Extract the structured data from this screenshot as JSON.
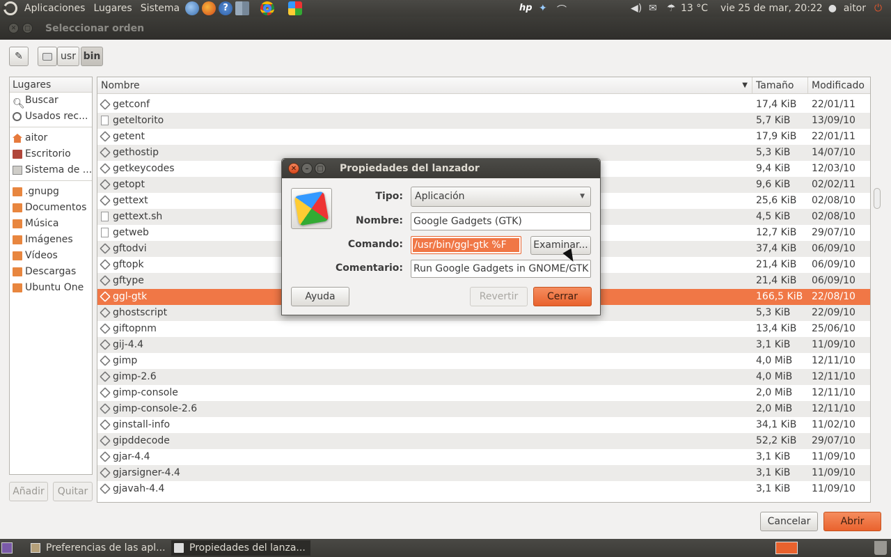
{
  "topbar": {
    "menus": [
      "Aplicaciones",
      "Lugares",
      "Sistema"
    ],
    "temperature": "13 °C",
    "datetime": "vie 25 de mar, 20:22",
    "user": "aitor"
  },
  "window": {
    "title": "Seleccionar orden"
  },
  "path": {
    "segments": [
      "usr",
      "bin"
    ],
    "active": "bin"
  },
  "places": {
    "header": "Lugares",
    "items": [
      "Buscar",
      "Usados rec...",
      "aitor",
      "Escritorio",
      "Sistema de ...",
      ".gnupg",
      "Documentos",
      "Música",
      "Imágenes",
      "Vídeos",
      "Descargas",
      "Ubuntu One"
    ],
    "add_label": "Añadir",
    "remove_label": "Quitar"
  },
  "files": {
    "columns": {
      "name": "Nombre",
      "size": "Tamaño",
      "modified": "Modificado"
    },
    "rows": [
      {
        "name": "getconf",
        "size": "17,4 KiB",
        "modified": "22/01/11"
      },
      {
        "name": "geteltorito",
        "size": "5,7 KiB",
        "modified": "13/09/10"
      },
      {
        "name": "getent",
        "size": "17,9 KiB",
        "modified": "22/01/11"
      },
      {
        "name": "gethostip",
        "size": "5,3 KiB",
        "modified": "14/07/10"
      },
      {
        "name": "getkeycodes",
        "size": "9,4 KiB",
        "modified": "12/03/10"
      },
      {
        "name": "getopt",
        "size": "9,6 KiB",
        "modified": "02/02/11"
      },
      {
        "name": "gettext",
        "size": "25,6 KiB",
        "modified": "02/08/10"
      },
      {
        "name": "gettext.sh",
        "size": "4,5 KiB",
        "modified": "02/08/10"
      },
      {
        "name": "getweb",
        "size": "12,7 KiB",
        "modified": "29/07/10"
      },
      {
        "name": "gftodvi",
        "size": "37,4 KiB",
        "modified": "06/09/10"
      },
      {
        "name": "gftopk",
        "size": "21,4 KiB",
        "modified": "06/09/10"
      },
      {
        "name": "gftype",
        "size": "21,4 KiB",
        "modified": "06/09/10"
      },
      {
        "name": "ggl-gtk",
        "size": "166,5 KiB",
        "modified": "22/08/10"
      },
      {
        "name": "ghostscript",
        "size": "5,3 KiB",
        "modified": "22/09/10"
      },
      {
        "name": "giftopnm",
        "size": "13,4 KiB",
        "modified": "25/06/10"
      },
      {
        "name": "gij-4.4",
        "size": "3,1 KiB",
        "modified": "11/09/10"
      },
      {
        "name": "gimp",
        "size": "4,0 MiB",
        "modified": "12/11/10"
      },
      {
        "name": "gimp-2.6",
        "size": "4,0 MiB",
        "modified": "12/11/10"
      },
      {
        "name": "gimp-console",
        "size": "2,0 MiB",
        "modified": "12/11/10"
      },
      {
        "name": "gimp-console-2.6",
        "size": "2,0 MiB",
        "modified": "12/11/10"
      },
      {
        "name": "ginstall-info",
        "size": "34,1 KiB",
        "modified": "11/02/10"
      },
      {
        "name": "gipddecode",
        "size": "52,2 KiB",
        "modified": "29/07/10"
      },
      {
        "name": "gjar-4.4",
        "size": "3,1 KiB",
        "modified": "11/09/10"
      },
      {
        "name": "gjarsigner-4.4",
        "size": "3,1 KiB",
        "modified": "11/09/10"
      },
      {
        "name": "gjavah-4.4",
        "size": "3,1 KiB",
        "modified": "11/09/10"
      }
    ],
    "selected": "ggl-gtk"
  },
  "footer": {
    "cancel_label": "Cancelar",
    "open_label": "Abrir"
  },
  "dialog": {
    "title": "Propiedades del lanzador",
    "type_label": "Tipo:",
    "type_value": "Aplicación",
    "name_label": "Nombre:",
    "name_value": "Google Gadgets (GTK)",
    "command_label": "Comando:",
    "command_value": "/usr/bin/ggl-gtk %F",
    "browse_label": "Examinar...",
    "comment_label": "Comentario:",
    "comment_value": "Run Google Gadgets in GNOME/GTK e",
    "help_label": "Ayuda",
    "revert_label": "Revertir",
    "close_label": "Cerrar"
  },
  "taskbar": {
    "tasks": [
      "Preferencias de las apl...",
      "Propiedades del lanza..."
    ]
  },
  "colors": {
    "accent": "#f07746",
    "panel": "#3c3b37"
  }
}
